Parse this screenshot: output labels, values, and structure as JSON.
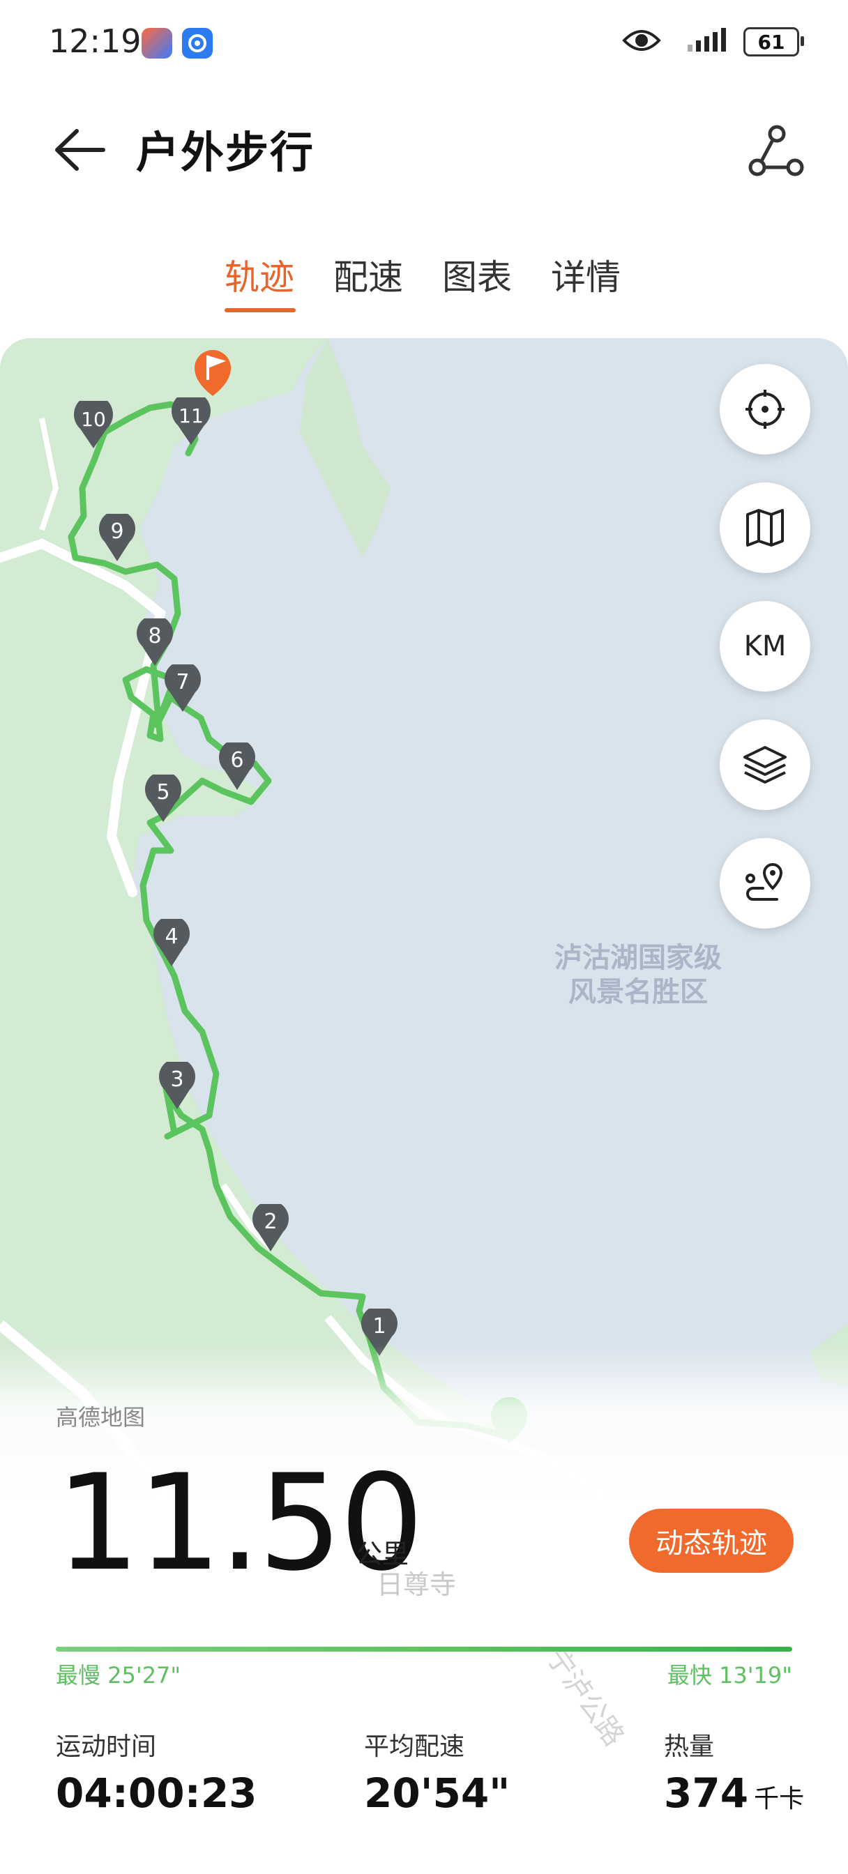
{
  "status_bar": {
    "time": "12:19",
    "battery": "61",
    "icons": [
      "app-icon-1",
      "app-icon-2",
      "eye-icon",
      "signal-icon",
      "battery-icon"
    ]
  },
  "header": {
    "title": "户外步行",
    "back_icon": "arrow-left-icon",
    "share_icon": "share-route-icon"
  },
  "tabs": [
    {
      "label": "轨迹",
      "active": true
    },
    {
      "label": "配速",
      "active": false
    },
    {
      "label": "图表",
      "active": false
    },
    {
      "label": "详情",
      "active": false
    }
  ],
  "map": {
    "poi_line1": "泸沽湖国家级",
    "poi_line2": "风景名胜区",
    "temple": "日尊寺",
    "road": "宁泸公路",
    "attribution": "高德地图",
    "markers": [
      "1",
      "2",
      "3",
      "4",
      "5",
      "6",
      "7",
      "8",
      "9",
      "10",
      "11"
    ],
    "controls": [
      {
        "name": "locate-button",
        "icon": "crosshair-icon"
      },
      {
        "name": "map-type-button",
        "icon": "map-icon"
      },
      {
        "name": "km-button",
        "label": "KM"
      },
      {
        "name": "layers-button",
        "icon": "layers-icon"
      },
      {
        "name": "route-button",
        "icon": "route-pin-icon"
      }
    ],
    "colors": {
      "water": "#d9e3ec",
      "land": "#d3ead3",
      "route": "#5cc45f",
      "marker": "#555a5e"
    }
  },
  "summary": {
    "distance": "11.50",
    "distance_unit": "公里",
    "dynamic_button": "动态轨迹",
    "slowest": "最慢 25'27\"",
    "fastest": "最快 13'19\""
  },
  "stats": [
    {
      "label": "运动时间",
      "value": "04:00:23",
      "unit": ""
    },
    {
      "label": "平均配速",
      "value": "20'54\"",
      "unit": ""
    },
    {
      "label": "热量",
      "value": "374",
      "unit": "千卡"
    }
  ],
  "accent_color": "#e8642a"
}
